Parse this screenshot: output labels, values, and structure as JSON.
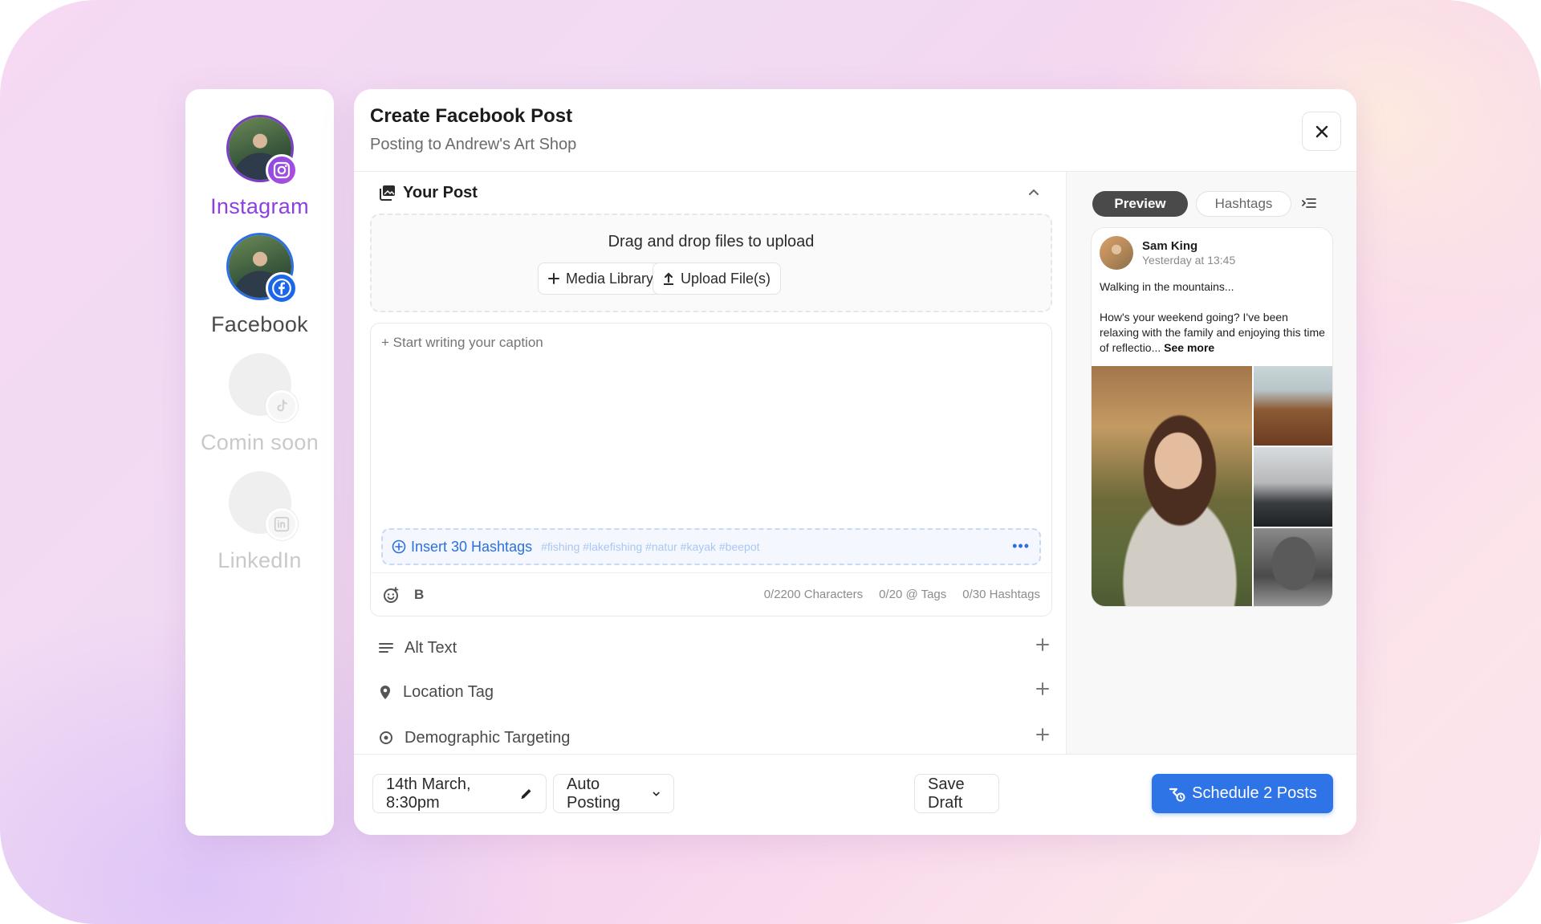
{
  "sidebar": {
    "accounts": [
      {
        "label": "Instagram",
        "network": "instagram",
        "status": "active"
      },
      {
        "label": "Facebook",
        "network": "facebook",
        "status": "connected"
      },
      {
        "label": "Comin soon",
        "network": "tiktok",
        "status": "disabled"
      },
      {
        "label": "LinkedIn",
        "network": "linkedin",
        "status": "disabled"
      }
    ]
  },
  "modal": {
    "title": "Create Facebook Post",
    "subtitle": "Posting to Andrew's Art Shop",
    "close_icon": "close-icon"
  },
  "post": {
    "section_label": "Your Post",
    "dropzone_text": "Drag and drop files to upload",
    "media_library_label": "Media Library",
    "upload_label": "Upload File(s)",
    "caption_placeholder": "+ Start writing your caption",
    "caption_value": "",
    "insert_hashtags_label": "Insert 30 Hashtags",
    "hashtag_suggestions": "#fishing #lakefishing #natur #kayak #beepot",
    "more_label": "•••",
    "bold_label": "B",
    "counts": {
      "characters": "0/2200 Characters",
      "tags": "0/20 @ Tags",
      "hashtags": "0/30 Hashtags"
    }
  },
  "options": [
    {
      "label": "Alt Text",
      "icon": "lines-icon"
    },
    {
      "label": "Location Tag",
      "icon": "location-pin-icon"
    },
    {
      "label": "Demographic Targeting",
      "icon": "target-icon"
    }
  ],
  "preview": {
    "tabs": [
      {
        "label": "Preview",
        "active": true
      },
      {
        "label": "Hashtags",
        "active": false
      }
    ],
    "user_name": "Sam King",
    "time": "Yesterday at 13:45",
    "line1": "Walking in the mountains...",
    "line2": "How's your weekend going? I've been relaxing with the family and enjoying this time of reflectio...",
    "see_more": "See more"
  },
  "footer": {
    "date_label": "14th March, 8:30pm",
    "posting_mode": "Auto Posting",
    "save_draft_label": "Save Draft",
    "schedule_label": "Schedule 2 Posts"
  },
  "colors": {
    "instagram": "#8d3fe0",
    "facebook": "#1b67e8",
    "primary": "#2f74e6",
    "hashtag_accent": "#2b6fe3"
  }
}
